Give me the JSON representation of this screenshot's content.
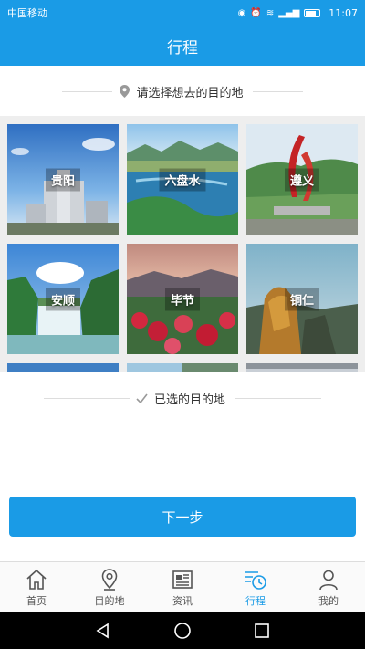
{
  "status_bar": {
    "carrier": "中国移动",
    "time": "11:07"
  },
  "header": {
    "title": "行程"
  },
  "select_prompt": "请选择想去的目的地",
  "selected_header": "已选的目的地",
  "destinations": [
    {
      "name": "贵阳"
    },
    {
      "name": "六盘水"
    },
    {
      "name": "遵义"
    },
    {
      "name": "安顺"
    },
    {
      "name": "毕节"
    },
    {
      "name": "铜仁"
    }
  ],
  "next_button": "下一步",
  "tabs": [
    {
      "label": "首页",
      "icon": "home-icon",
      "active": false
    },
    {
      "label": "目的地",
      "icon": "location-icon",
      "active": false
    },
    {
      "label": "资讯",
      "icon": "news-icon",
      "active": false
    },
    {
      "label": "行程",
      "icon": "itinerary-icon",
      "active": true
    },
    {
      "label": "我的",
      "icon": "profile-icon",
      "active": false
    }
  ],
  "colors": {
    "accent": "#1a9be6",
    "background": "#ffffff",
    "grid_background": "#eeeeee"
  }
}
